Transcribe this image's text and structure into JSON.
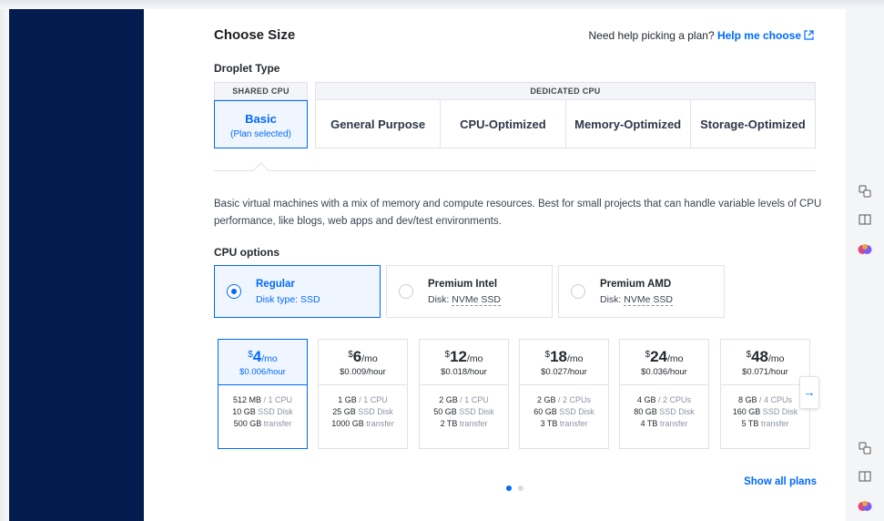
{
  "header": {
    "title": "Choose Size",
    "help_text": "Need help picking a plan?",
    "help_link": "Help me choose"
  },
  "droplet_type": {
    "label": "Droplet Type",
    "shared_header": "SHARED CPU",
    "dedicated_header": "DEDICATED CPU",
    "basic": {
      "name": "Basic",
      "status": "(Plan selected)"
    },
    "dedicated_options": [
      "General Purpose",
      "CPU-Optimized",
      "Memory-Optimized",
      "Storage-Optimized"
    ]
  },
  "description": "Basic virtual machines with a mix of memory and compute resources. Best for small projects that can handle variable levels of CPU performance, like blogs, web apps and dev/test environments.",
  "cpu_options": {
    "label": "CPU options",
    "options": [
      {
        "name": "Regular",
        "disk_prefix": "Disk type: ",
        "disk": "SSD",
        "selected": true
      },
      {
        "name": "Premium Intel",
        "disk_prefix": "Disk: ",
        "disk": "NVMe SSD",
        "selected": false
      },
      {
        "name": "Premium AMD",
        "disk_prefix": "Disk: ",
        "disk": "NVMe SSD",
        "selected": false
      }
    ]
  },
  "plans": [
    {
      "currency": "$",
      "price": "4",
      "per": "/mo",
      "hourly": "$0.006/hour",
      "mem": "512 MB",
      "cpu": "/ 1 CPU",
      "disk": "10 GB",
      "disk_type": "SSD Disk",
      "transfer": "500 GB",
      "transfer_label": "transfer",
      "selected": true
    },
    {
      "currency": "$",
      "price": "6",
      "per": "/mo",
      "hourly": "$0.009/hour",
      "mem": "1 GB",
      "cpu": "/ 1 CPU",
      "disk": "25 GB",
      "disk_type": "SSD Disk",
      "transfer": "1000 GB",
      "transfer_label": "transfer",
      "selected": false
    },
    {
      "currency": "$",
      "price": "12",
      "per": "/mo",
      "hourly": "$0.018/hour",
      "mem": "2 GB",
      "cpu": "/ 1 CPU",
      "disk": "50 GB",
      "disk_type": "SSD Disk",
      "transfer": "2 TB",
      "transfer_label": "transfer",
      "selected": false
    },
    {
      "currency": "$",
      "price": "18",
      "per": "/mo",
      "hourly": "$0.027/hour",
      "mem": "2 GB",
      "cpu": "/ 2 CPUs",
      "disk": "60 GB",
      "disk_type": "SSD Disk",
      "transfer": "3 TB",
      "transfer_label": "transfer",
      "selected": false
    },
    {
      "currency": "$",
      "price": "24",
      "per": "/mo",
      "hourly": "$0.036/hour",
      "mem": "4 GB",
      "cpu": "/ 2 CPUs",
      "disk": "80 GB",
      "disk_type": "SSD Disk",
      "transfer": "4 TB",
      "transfer_label": "transfer",
      "selected": false
    },
    {
      "currency": "$",
      "price": "48",
      "per": "/mo",
      "hourly": "$0.071/hour",
      "mem": "8 GB",
      "cpu": "/ 4 CPUs",
      "disk": "160 GB",
      "disk_type": "SSD Disk",
      "transfer": "5 TB",
      "transfer_label": "transfer",
      "selected": false
    }
  ],
  "carousel": {
    "next_icon": "arrow-right-icon",
    "arrow_glyph": "→",
    "page_count": 2,
    "current_page": 1
  },
  "show_all": "Show all plans",
  "colors": {
    "accent": "#0069ff",
    "sidebar": "#031b4e",
    "border": "#dfe3e8"
  },
  "rail_icons": [
    "translate-icon",
    "reader-icon",
    "brain-icon",
    "translate-icon",
    "reader-icon",
    "brain-icon"
  ]
}
